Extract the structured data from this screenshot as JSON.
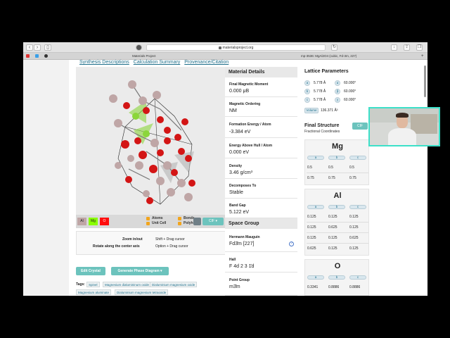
{
  "browser": {
    "address": "materialsproject.org",
    "tabs": [
      "Materials Project",
      "mp-3536: MgAl2O4 (cubic, Fd-3m, 227)"
    ]
  },
  "subnav": [
    "Synthesis Descriptions",
    "Calculation Summary",
    "Provenance/Citation"
  ],
  "viewer": {
    "elements": [
      {
        "symbol": "Al",
        "color": "#bfa6a6"
      },
      {
        "symbol": "Mg",
        "color": "#8aff00"
      },
      {
        "symbol": "O",
        "color": "#ff0d0d"
      }
    ],
    "checkboxes": [
      "Atoms",
      "Unit Cell",
      "Bonds",
      "Polyhedra"
    ],
    "cif_button": "CIF ▾",
    "help": [
      {
        "label": "Zoom in/out",
        "action": "Shift + Drag cursor"
      },
      {
        "label": "Rotate along the center axis",
        "action": "Option + Drag cursor"
      }
    ]
  },
  "actions": {
    "edit_crystal": "Edit Crystal",
    "phase_diagram": "Generate Phase Diagram ▾"
  },
  "tags": {
    "label": "Tags:",
    "items": [
      "Spinel",
      "Magnesium dialumininum oxide",
      "Dialuminium magnesium oxide",
      "Magnesium aluminate",
      "Dialuminium magnesium tetraoxide"
    ]
  },
  "material_details": {
    "title": "Material Details",
    "rows": [
      {
        "label": "Final Magnetic Moment",
        "value": "0.000 μB"
      },
      {
        "label": "Magnetic Ordering",
        "value": "NM"
      },
      {
        "label": "Formation Energy / Atom",
        "value": "-3.384 eV"
      },
      {
        "label": "Energy Above Hull / Atom",
        "value": "0.000 eV"
      },
      {
        "label": "Density",
        "value": "3.46 g/cm³"
      },
      {
        "label": "Decomposes To",
        "value": "Stable"
      },
      {
        "label": "Band Gap",
        "value": "5.122 eV"
      }
    ]
  },
  "space_group": {
    "title": "Space Group",
    "rows": [
      {
        "label": "Hermann Mauguin",
        "value": "Fd3̄m [227]"
      },
      {
        "label": "Hall",
        "value": "F 4d 2 3 1̄d"
      },
      {
        "label": "Point Group",
        "value": "m3̄m"
      }
    ]
  },
  "lattice": {
    "title": "Lattice Parameters",
    "lengths": [
      {
        "key": "a",
        "value": "5.778 Å"
      },
      {
        "key": "b",
        "value": "5.778 Å"
      },
      {
        "key": "c",
        "value": "5.778 Å"
      }
    ],
    "angles": [
      {
        "key": "α",
        "value": "60.000°"
      },
      {
        "key": "β",
        "value": "60.000°"
      },
      {
        "key": "γ",
        "value": "60.000°"
      }
    ],
    "volume_label": "Volume",
    "volume_value": "136.371 Å³"
  },
  "final_structure": {
    "title": "Final Structure",
    "subtitle": "Fractional Coordinates",
    "cif": "CIF",
    "columns": [
      "a",
      "b",
      "c"
    ],
    "elements": [
      {
        "name": "Mg",
        "rows": [
          [
            "0.5",
            "0.5",
            "0.5"
          ],
          [
            "0.75",
            "0.75",
            "0.75"
          ]
        ]
      },
      {
        "name": "Al",
        "rows": [
          [
            "0.125",
            "0.125",
            "0.125"
          ],
          [
            "0.125",
            "0.625",
            "0.125"
          ],
          [
            "0.125",
            "0.125",
            "0.625"
          ],
          [
            "0.625",
            "0.125",
            "0.125"
          ]
        ]
      },
      {
        "name": "O",
        "rows": [
          [
            "0.3341",
            "0.8886",
            "0.8886"
          ]
        ]
      }
    ]
  }
}
